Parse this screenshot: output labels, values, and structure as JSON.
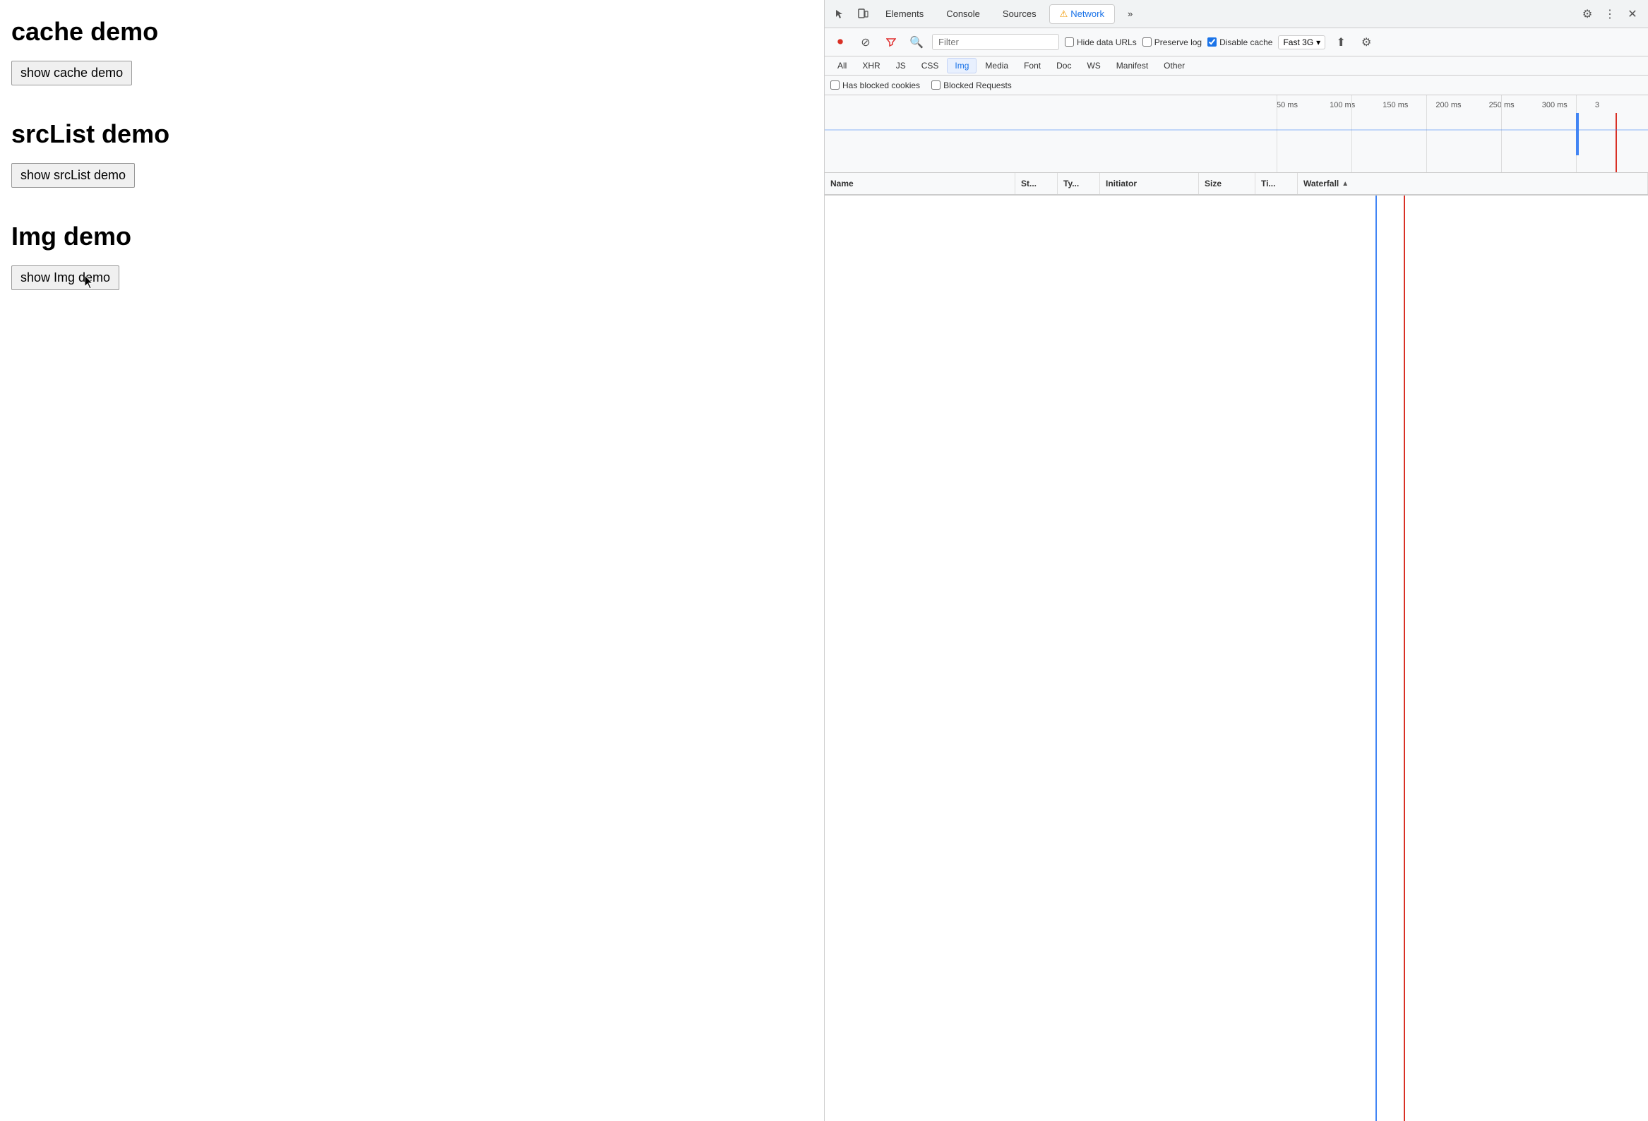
{
  "main": {
    "sections": [
      {
        "id": "cache-demo",
        "title": "cache demo",
        "button_label": "show cache demo"
      },
      {
        "id": "srclist-demo",
        "title": "srcList demo",
        "button_label": "show srcList demo"
      },
      {
        "id": "img-demo",
        "title": "Img demo",
        "button_label": "show Img demo"
      }
    ]
  },
  "devtools": {
    "tabs": [
      {
        "label": "Elements",
        "active": false
      },
      {
        "label": "Console",
        "active": false
      },
      {
        "label": "Sources",
        "active": false
      },
      {
        "label": "Network",
        "active": true
      },
      {
        "label": "»",
        "active": false
      }
    ],
    "icons": {
      "cursor": "⊹",
      "device": "▭",
      "gear": "⚙",
      "dots": "⋮",
      "close": "✕"
    },
    "network": {
      "filter_placeholder": "Filter",
      "hide_data_urls_label": "Hide data URLs",
      "preserve_log_label": "Preserve log",
      "disable_cache_label": "Disable cache",
      "disable_cache_checked": true,
      "throttle_label": "Fast 3G",
      "filter_tabs": [
        {
          "label": "All",
          "active": false
        },
        {
          "label": "XHR",
          "active": false
        },
        {
          "label": "JS",
          "active": false
        },
        {
          "label": "CSS",
          "active": false
        },
        {
          "label": "Img",
          "active": true
        },
        {
          "label": "Media",
          "active": false
        },
        {
          "label": "Font",
          "active": false
        },
        {
          "label": "Doc",
          "active": false
        },
        {
          "label": "WS",
          "active": false
        },
        {
          "label": "Manifest",
          "active": false
        },
        {
          "label": "Other",
          "active": false
        }
      ],
      "blocked_cookies_label": "Has blocked cookies",
      "blocked_requests_label": "Blocked Requests",
      "timeline_marks": [
        "50 ms",
        "100 ms",
        "150 ms",
        "200 ms",
        "250 ms",
        "300 ms",
        "3"
      ],
      "columns": {
        "name": "Name",
        "status": "St...",
        "type": "Ty...",
        "initiator": "Initiator",
        "size": "Size",
        "time": "Ti...",
        "waterfall": "Waterfall"
      }
    }
  }
}
